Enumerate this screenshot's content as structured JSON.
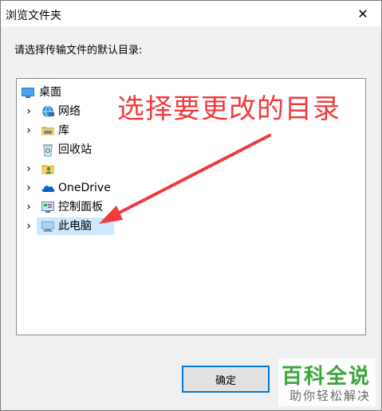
{
  "window": {
    "title": "浏览文件夹",
    "close_glyph": "✕"
  },
  "prompt": "请选择传输文件的默认目录:",
  "tree": {
    "items": [
      {
        "label": "桌面",
        "icon": "desktop-icon",
        "expandable": false,
        "level": 0
      },
      {
        "label": "网络",
        "icon": "network-icon",
        "expandable": true,
        "level": 1
      },
      {
        "label": "库",
        "icon": "library-folder-icon",
        "expandable": true,
        "level": 1
      },
      {
        "label": "回收站",
        "icon": "recycle-bin-icon",
        "expandable": false,
        "level": 1
      },
      {
        "label": "",
        "icon": "user-folder-icon",
        "expandable": true,
        "level": 1
      },
      {
        "label": "OneDrive",
        "icon": "onedrive-cloud-icon",
        "expandable": true,
        "level": 1
      },
      {
        "label": "控制面板",
        "icon": "control-panel-icon",
        "expandable": true,
        "level": 1
      },
      {
        "label": "此电脑",
        "icon": "this-pc-icon",
        "expandable": true,
        "level": 1,
        "selected": true
      }
    ],
    "chevron_glyph": "›"
  },
  "annotation": {
    "text": "选择要更改的目录",
    "color": "#ef3b3b"
  },
  "buttons": {
    "ok_label": "确定"
  },
  "watermark": {
    "title": "百科全说",
    "subtitle": "助你轻松解决",
    "color": "#3aa53a"
  },
  "colors": {
    "selection": "#cce8ff",
    "focus_border": "#0078d7"
  }
}
